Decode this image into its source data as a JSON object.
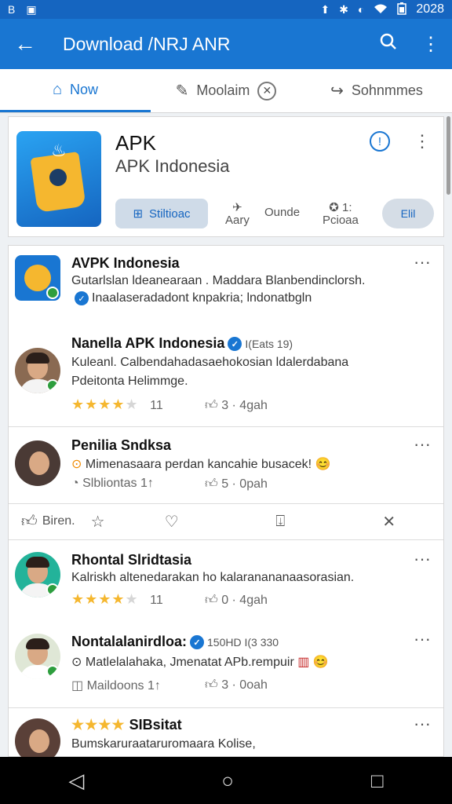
{
  "status_bar": {
    "time": "2028",
    "left_icons": [
      "B",
      "▣"
    ],
    "right_icons": [
      "⬆",
      "✱",
      "◐",
      "wifi",
      "battery"
    ]
  },
  "app_bar": {
    "title": "Download /NRJ ANR"
  },
  "tabs": [
    {
      "label": "Now",
      "icon": "home-icon"
    },
    {
      "label": "Moolaim",
      "icon": "chat-icon"
    },
    {
      "label": "Sohnmmes",
      "icon": "share-icon"
    }
  ],
  "app_card": {
    "name": "APK",
    "developer": "APK Indonesia",
    "primary_button": "Stiltioac",
    "stat1": {
      "top": "Aary",
      "label": ""
    },
    "stat2": {
      "label": "Ounde"
    },
    "stat3": {
      "top": "1:",
      "label": "Pcioaa"
    },
    "secondary_button": "Elil"
  },
  "feed": {
    "row1": {
      "title": "AVPK Indonesia",
      "line1": "Gutarlslan ldeanearaan . Maddara Blanbendinclorsh.",
      "line2": "Inaalaseradadont knpakria; lndonatbgln"
    },
    "row2": {
      "title": "Nanella APK Indonesia",
      "extra": "I(Eats 19)",
      "line1": "Kuleanl. Calbendahadasaehokosian ldalerdabana",
      "line2": "Pdeitonta Helimmge.",
      "rating_count": "11",
      "likes": "3 · 4gah"
    },
    "row3": {
      "title": "Penilia Sndksa",
      "line1": "Mimenasaara perdan kancahie busacek!",
      "meta_left": "Slbliontas 1↑",
      "likes": "5 · 0pah"
    },
    "actions": {
      "like_label": "Biren."
    },
    "row4": {
      "title": "Rhontal Slridtasia",
      "line1": "Kalriskh altenedarakan ho kalaranananaasorasian.",
      "rating_count": "11",
      "likes": "0 · 4gah"
    },
    "row5": {
      "title": "Nontalalanirdloa:",
      "extra": "150HD I(3 330",
      "line1": "Matlelalahaka, Jmenatat APb.rempuir",
      "meta_left": "Maildoons 1↑",
      "likes": "3 · 0oah"
    },
    "row6": {
      "title": "SIBsitat",
      "line1": "Bumskaruraataruromaara Kolise,"
    }
  }
}
